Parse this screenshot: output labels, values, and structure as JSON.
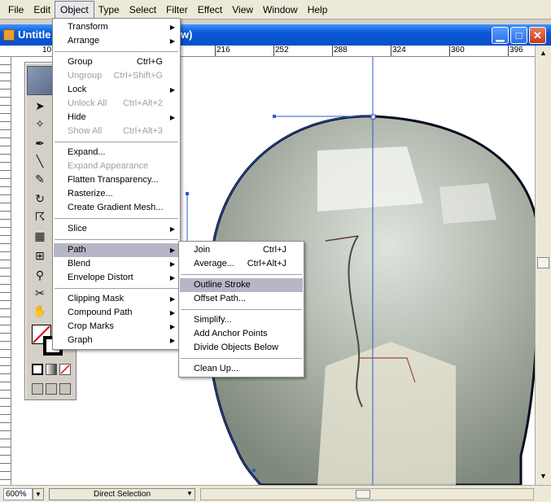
{
  "menubar": {
    "items": [
      "File",
      "Edit",
      "Object",
      "Type",
      "Select",
      "Filter",
      "Effect",
      "View",
      "Window",
      "Help"
    ]
  },
  "window": {
    "title_left": "Untitle",
    "title_right": "w)",
    "minimize_glyph": "▁",
    "maximize_glyph": "□",
    "close_glyph": "✕"
  },
  "ruler": {
    "ticks": [
      "10",
      "216",
      "252",
      "288",
      "324",
      "360",
      "396"
    ]
  },
  "status": {
    "zoom": "600%",
    "tool": "Direct Selection"
  },
  "object_menu": {
    "items": [
      {
        "label": "Transform",
        "shortcut": "",
        "submenu": true,
        "disabled": false
      },
      {
        "label": "Arrange",
        "shortcut": "",
        "submenu": true,
        "disabled": false
      },
      {
        "label": "Group",
        "shortcut": "Ctrl+G",
        "submenu": false,
        "disabled": false
      },
      {
        "label": "Ungroup",
        "shortcut": "Ctrl+Shift+G",
        "submenu": false,
        "disabled": true
      },
      {
        "label": "Lock",
        "shortcut": "",
        "submenu": true,
        "disabled": false
      },
      {
        "label": "Unlock All",
        "shortcut": "Ctrl+Alt+2",
        "submenu": false,
        "disabled": true
      },
      {
        "label": "Hide",
        "shortcut": "",
        "submenu": true,
        "disabled": false
      },
      {
        "label": "Show All",
        "shortcut": "Ctrl+Alt+3",
        "submenu": false,
        "disabled": true
      },
      {
        "label": "Expand...",
        "shortcut": "",
        "submenu": false,
        "disabled": false
      },
      {
        "label": "Expand Appearance",
        "shortcut": "",
        "submenu": false,
        "disabled": true
      },
      {
        "label": "Flatten Transparency...",
        "shortcut": "",
        "submenu": false,
        "disabled": false
      },
      {
        "label": "Rasterize...",
        "shortcut": "",
        "submenu": false,
        "disabled": false
      },
      {
        "label": "Create Gradient Mesh...",
        "shortcut": "",
        "submenu": false,
        "disabled": false
      },
      {
        "label": "Slice",
        "shortcut": "",
        "submenu": true,
        "disabled": false
      },
      {
        "label": "Path",
        "shortcut": "",
        "submenu": true,
        "disabled": false
      },
      {
        "label": "Blend",
        "shortcut": "",
        "submenu": true,
        "disabled": false
      },
      {
        "label": "Envelope Distort",
        "shortcut": "",
        "submenu": true,
        "disabled": false
      },
      {
        "label": "Clipping Mask",
        "shortcut": "",
        "submenu": true,
        "disabled": false
      },
      {
        "label": "Compound Path",
        "shortcut": "",
        "submenu": true,
        "disabled": false
      },
      {
        "label": "Crop Marks",
        "shortcut": "",
        "submenu": true,
        "disabled": false
      },
      {
        "label": "Graph",
        "shortcut": "",
        "submenu": true,
        "disabled": false
      }
    ]
  },
  "path_menu": {
    "items": [
      {
        "label": "Join",
        "shortcut": "Ctrl+J"
      },
      {
        "label": "Average...",
        "shortcut": "Ctrl+Alt+J"
      },
      {
        "label": "Outline Stroke",
        "shortcut": ""
      },
      {
        "label": "Offset Path...",
        "shortcut": ""
      },
      {
        "label": "Simplify...",
        "shortcut": ""
      },
      {
        "label": "Add Anchor Points",
        "shortcut": ""
      },
      {
        "label": "Divide Objects Below",
        "shortcut": ""
      },
      {
        "label": "Clean Up...",
        "shortcut": ""
      }
    ],
    "highlighted": "Outline Stroke"
  },
  "colors": {
    "title_bar": "#0a57d8",
    "menu_highlight": "#b6b6c6",
    "bulb_glass": "#9aa39a",
    "path_selection": "#2a5ad0"
  },
  "icons": {
    "pointer": "pointer-icon",
    "magic_wand": "magic-wand-icon",
    "pen": "pen-icon",
    "line": "line-segment-icon",
    "brush": "paintbrush-icon",
    "rotate": "rotate-icon",
    "warp": "warp-icon",
    "graph": "graph-icon",
    "mesh": "mesh-icon",
    "eyedropper": "eyedropper-icon",
    "scissors": "scissors-icon",
    "hand": "hand-icon"
  }
}
